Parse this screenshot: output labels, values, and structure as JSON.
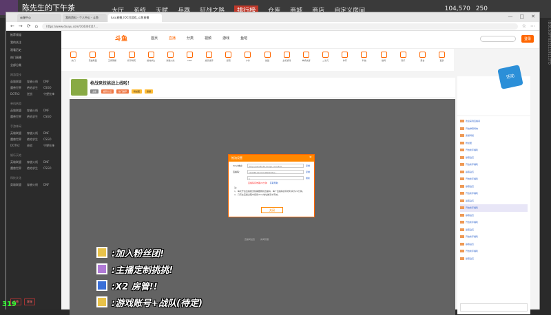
{
  "stream": {
    "streamer_name": "陈先生的下午茶",
    "game_menu": [
      "大厅",
      "系统",
      "天赋",
      "兵器",
      "征战之路",
      "排行榜",
      "仓库",
      "商城",
      "商店",
      "自定义房间"
    ],
    "resources": [
      "104,570",
      "250"
    ],
    "fps": "319",
    "side_text": "IDD1SOFT0231119112TD"
  },
  "browser": {
    "tabs": [
      "云服中心",
      "我的资料 - 个人中心 - 斗鱼",
      "lusu直播_IOC打游戏_斗鱼直播"
    ],
    "url": "https://www.douyu.com/10434611?..."
  },
  "site": {
    "logo": "斗鱼",
    "nav": [
      "首页",
      "直播",
      "分类",
      "视频",
      "游戏",
      "鱼吧"
    ],
    "login": "登录",
    "categories": [
      "热门",
      "英雄联盟",
      "王者荣耀",
      "和平精英",
      "绝地求生",
      "穿越火线",
      "DNF",
      "魔兽世界",
      "颜值",
      "户外",
      "舞蹈",
      "主机游戏",
      "单机热游",
      "二次元",
      "体育",
      "科技",
      "数码",
      "音乐",
      "美食",
      "更多"
    ],
    "sidebar_items": [
      "推荐频道",
      "我的关注",
      "观看历史",
      "热门直播",
      "全部分类"
    ],
    "sidebar_group_1": "网游竞技",
    "sidebar_group_2": "单机热游",
    "sidebar_group_3": "手游休闲",
    "sidebar_group_4": "娱乐天地",
    "sidebar_group_5": "科技文化",
    "sidebar_games": [
      "英雄联盟",
      "穿越火线",
      "DNF",
      "魔兽世界",
      "绝地求生",
      "CSGO",
      "DOTA2",
      "逆战",
      "守望先锋"
    ],
    "sidebar_bottom": [
      "开播",
      "客服"
    ]
  },
  "room": {
    "title": "枪战竞技挑战上线啦！",
    "tags": [
      "主播",
      "超管认证",
      "热门推荐",
      "粉丝团",
      "贵族"
    ]
  },
  "modal": {
    "title": "推流设置",
    "close": "×",
    "rtmp_label": "rtmp地址：",
    "rtmp_value": "rtmp://sendtc3a.douyu.com/live",
    "rtmp_action": "复制",
    "code_label": "直播码：",
    "code_value": "10434611rOhm9NVk87ss...",
    "code_action": "复制",
    "select_value": "1",
    "sub_action": "刷新",
    "red_text": "直播码有效期20分钟",
    "help_link": "获取帮助",
    "notes": [
      "注：",
      "1、每次开启直播推流前需要刷新直播码，每个直播码的有效时间为20分钟。",
      "2、只有在直播过程中使用rtmp地址推流才有效。"
    ],
    "button": "关闭",
    "below": [
      "直播间设置",
      "房间管理"
    ]
  },
  "chat": {
    "promo": "活动",
    "messages": [
      "欢迎来到直播间",
      "开启弹幕特效",
      "贵族特权",
      "粉丝团",
      "开启新手福利",
      "赢取钻石",
      "开启新手福利",
      "赢取钻石",
      "开启新手福利",
      "赢取钻石",
      "开启新手福利",
      "赢取钻石",
      "开启新手福利",
      "赢取钻石",
      "开启新手福利",
      "赢取钻石",
      "开启新手福利",
      "赢取钻石",
      "开启新手福利",
      "赢取钻石"
    ]
  },
  "overlay": {
    "lines": [
      ":加入粉丝团!",
      ":主播定制挑挑!",
      ":X2 房管!!",
      ":游戏账号+战队(待定)"
    ]
  }
}
